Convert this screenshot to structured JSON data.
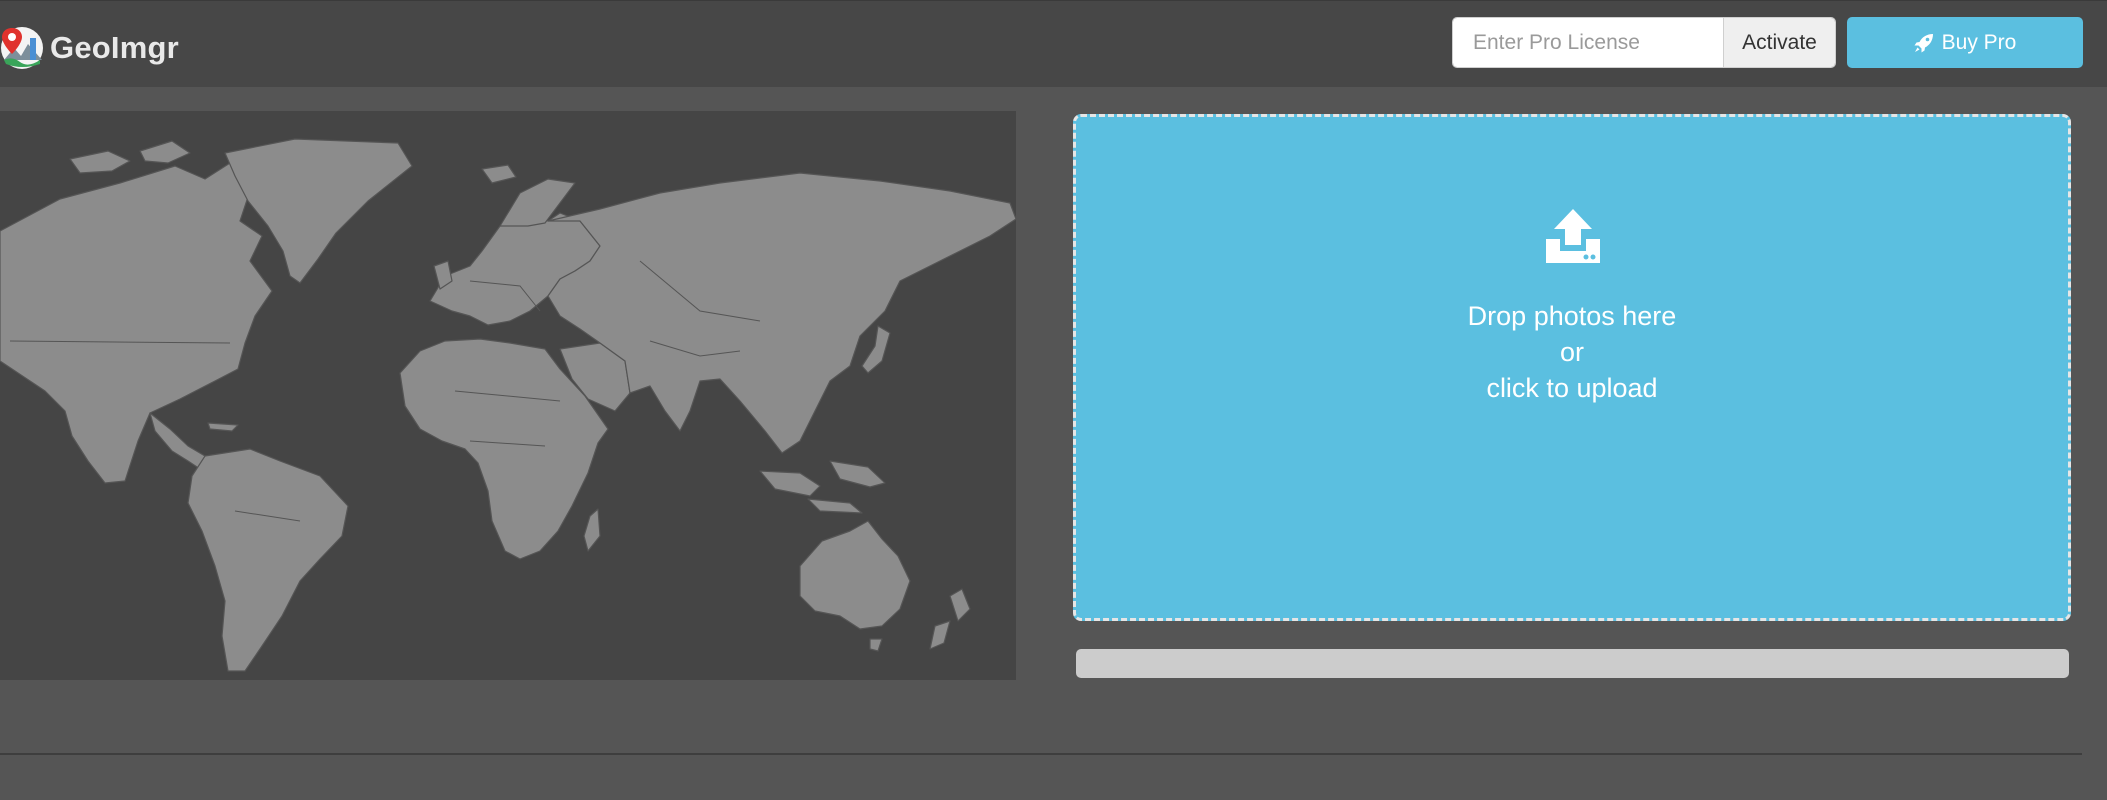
{
  "app": {
    "name": "GeoImgr",
    "logo_icon": "map-pin-logo-icon"
  },
  "header": {
    "license_placeholder": "Enter Pro License",
    "license_value": "",
    "activate_label": "Activate",
    "buy_label": "Buy Pro",
    "buy_icon": "rocket-icon"
  },
  "map": {
    "icon": "world-map"
  },
  "dropzone": {
    "icon": "upload-icon",
    "line1": "Drop photos here",
    "line2": "or",
    "line3": "click to upload"
  },
  "upload_progress": 0,
  "colors": {
    "accent": "#5bbfe0",
    "header_bg": "#474747",
    "page_bg": "#555555",
    "map_bg": "#454545",
    "land": "#8c8c8c",
    "progress_track": "#cccccc"
  }
}
